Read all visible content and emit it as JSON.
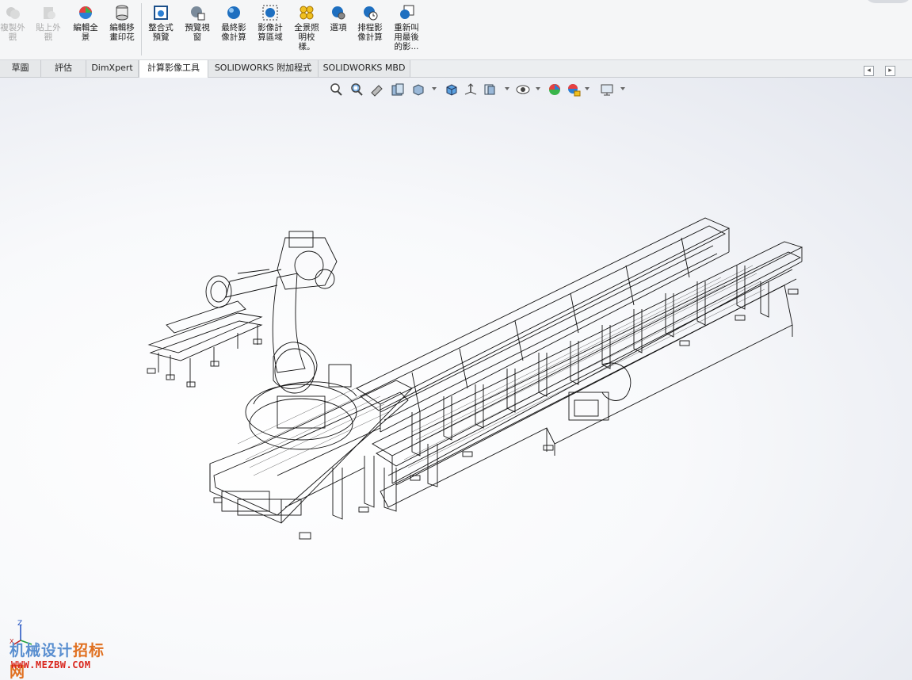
{
  "ribbon": {
    "buttons": [
      {
        "label": "複製外觀",
        "icon": "copy-appearance-icon",
        "enabled": false
      },
      {
        "label": "貼上外觀",
        "icon": "paste-appearance-icon",
        "enabled": false
      },
      {
        "label": "編輯全景",
        "icon": "edit-scene-icon",
        "enabled": true
      },
      {
        "label": "編輯移畫印花",
        "icon": "edit-decal-icon",
        "enabled": true
      },
      {
        "label": "整合式預覽",
        "icon": "integrated-preview-icon",
        "enabled": true
      },
      {
        "label": "預覽視窗",
        "icon": "preview-window-icon",
        "enabled": true
      },
      {
        "label": "最終影像計算",
        "icon": "final-render-icon",
        "enabled": true
      },
      {
        "label": "影像計算區域",
        "icon": "render-region-icon",
        "enabled": true
      },
      {
        "label": "全景照明校樣。",
        "icon": "scene-illumination-proof-icon",
        "enabled": true
      },
      {
        "label": "選項",
        "icon": "options-icon",
        "enabled": true
      },
      {
        "label": "排程影像計算",
        "icon": "schedule-render-icon",
        "enabled": true
      },
      {
        "label": "重新叫用最後的影...",
        "icon": "recall-last-render-icon",
        "enabled": true
      }
    ]
  },
  "tabs": [
    {
      "label": "草圖",
      "active": false
    },
    {
      "label": "評估",
      "active": false
    },
    {
      "label": "DimXpert",
      "active": false
    },
    {
      "label": "計算影像工具",
      "active": true
    },
    {
      "label": "SOLIDWORKS 附加程式",
      "active": false
    },
    {
      "label": "SOLIDWORKS MBD",
      "active": false
    }
  ],
  "hud": {
    "icons": [
      "zoom-to-fit-icon",
      "zoom-to-area-icon",
      "previous-view-icon",
      "section-view-icon",
      "view-orientation-icon",
      "display-style-icon",
      "hide-show-items-icon",
      "edit-appearance-icon",
      "apply-scene-icon",
      "view-settings-icon",
      "display-monitor-icon"
    ]
  },
  "triad": {
    "axis_z": "Z",
    "axis_x": "X"
  },
  "watermark": {
    "line1_part1": "机械设计",
    "line1_part2": "招标网",
    "line2": "WWW.MEZBW.COM"
  },
  "colors": {
    "ribbon_bg": "#f5f6f7",
    "tab_active_bg": "#ffffff",
    "wireframe": "#111111"
  }
}
